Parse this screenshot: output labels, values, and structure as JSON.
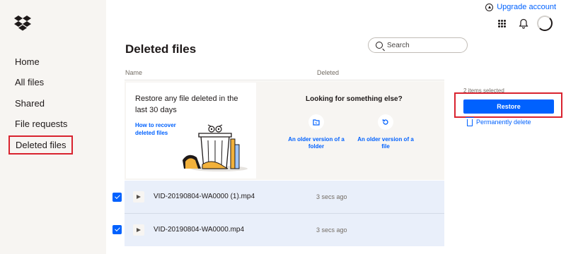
{
  "sidebar": {
    "logo_icon": "dropbox-logo-icon",
    "items": [
      {
        "label": "Home"
      },
      {
        "label": "All files"
      },
      {
        "label": "Shared"
      },
      {
        "label": "File requests"
      },
      {
        "label": "Deleted files"
      }
    ],
    "active_item": "Deleted files"
  },
  "topbar": {
    "upgrade_label": "Upgrade account",
    "upgrade_icon": "arrow-up-circle-icon",
    "apps_icon": "grid-icon",
    "notifications_icon": "bell-icon",
    "avatar_icon": "avatar"
  },
  "page": {
    "title": "Deleted files",
    "search": {
      "placeholder": "Search",
      "value": ""
    }
  },
  "table": {
    "headers": {
      "name": "Name",
      "deleted": "Deleted"
    },
    "rows": [
      {
        "name": "VID-20190804-WA0000 (1).mp4",
        "deleted": "3 secs ago",
        "checked": true,
        "icon": "video-file-icon"
      },
      {
        "name": "VID-20190804-WA0000.mp4",
        "deleted": "3 secs ago",
        "checked": true,
        "icon": "video-file-icon"
      }
    ]
  },
  "promo": {
    "heading": "Restore any file deleted in the last 30 days",
    "link": "How to recover deleted files",
    "right_title": "Looking for something else?",
    "options": [
      {
        "label": "An older version of a folder",
        "icon": "folder-restore-icon"
      },
      {
        "label": "An older version of a file",
        "icon": "history-icon"
      }
    ]
  },
  "selection_panel": {
    "count_text": "2 items selected",
    "restore_label": "Restore",
    "delete_label": "Permanently delete"
  },
  "colors": {
    "accent": "#0061fe",
    "highlight": "#d9232f",
    "sidebar_bg": "#f7f5f2",
    "selected_row_bg": "#e9effa"
  }
}
